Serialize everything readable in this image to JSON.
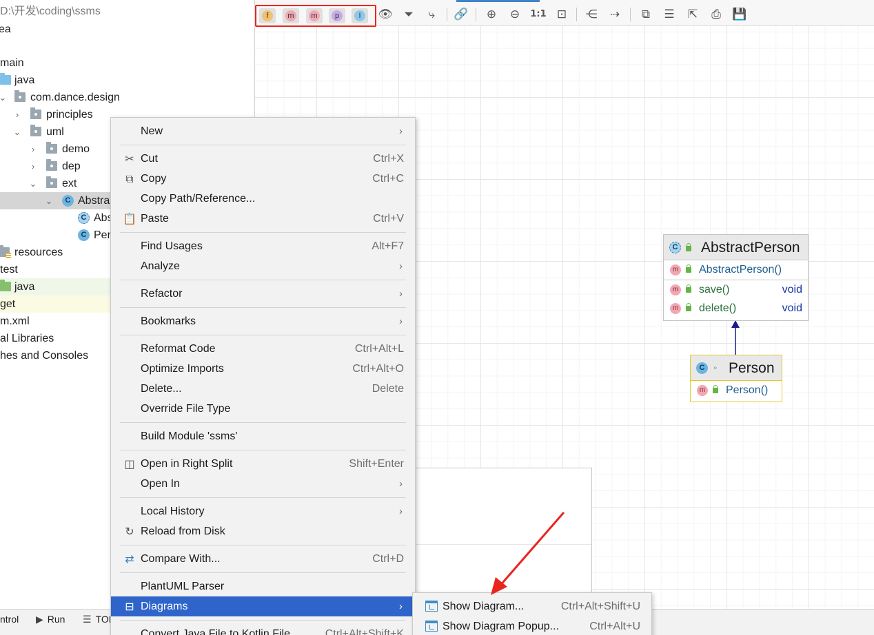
{
  "project": {
    "path_label": "D:\\开发\\coding\\ssms",
    "rows": [
      {
        "label": "ea"
      },
      {
        "label": ""
      },
      {
        "label": "main"
      },
      {
        "label": "java"
      },
      {
        "label": "com.dance.design"
      },
      {
        "label": "principles"
      },
      {
        "label": "uml"
      },
      {
        "label": "demo"
      },
      {
        "label": "dep"
      },
      {
        "label": "ext"
      },
      {
        "label": "AbstractPerson"
      },
      {
        "label": "AbstractPerson"
      },
      {
        "label": "Person"
      },
      {
        "label": "resources"
      },
      {
        "label": "test"
      },
      {
        "label": "java"
      },
      {
        "label": "get"
      },
      {
        "label": "m.xml"
      },
      {
        "label": "al Libraries"
      },
      {
        "label": "hes and Consoles"
      }
    ]
  },
  "bottom_bar": {
    "control_label": "ntrol",
    "run_label": "Run",
    "todo_label": "TODO"
  },
  "toolbar": {
    "filters": [
      {
        "letter": "f",
        "name": "fields",
        "color": "#f0c171"
      },
      {
        "letter": "m",
        "name": "constructors",
        "color": "#f2a7b3"
      },
      {
        "letter": "m",
        "name": "methods",
        "color": "#f2a7b3"
      },
      {
        "letter": "p",
        "name": "properties",
        "color": "#c7a8e8"
      },
      {
        "letter": "I",
        "name": "inner-classes",
        "color": "#8cc8e8"
      }
    ],
    "zoom_actual_label": "1:1"
  },
  "diagram": {
    "abstract_class": {
      "name": "AbstractPerson",
      "constructor": "AbstractPerson()",
      "methods": [
        {
          "name": "save()",
          "type": "void"
        },
        {
          "name": "delete()",
          "type": "void"
        }
      ]
    },
    "sub_class": {
      "name": "Person",
      "constructor": "Person()"
    }
  },
  "context_menu": {
    "new": "New",
    "cut": "Cut",
    "cut_sc": "Ctrl+X",
    "copy": "Copy",
    "copy_sc": "Ctrl+C",
    "copy_path": "Copy Path/Reference...",
    "paste": "Paste",
    "paste_sc": "Ctrl+V",
    "find_usages": "Find Usages",
    "find_usages_sc": "Alt+F7",
    "analyze": "Analyze",
    "refactor": "Refactor",
    "bookmarks": "Bookmarks",
    "reformat": "Reformat Code",
    "reformat_sc": "Ctrl+Alt+L",
    "optimize": "Optimize Imports",
    "optimize_sc": "Ctrl+Alt+O",
    "delete": "Delete...",
    "delete_sc": "Delete",
    "override": "Override File Type",
    "build_module": "Build Module 'ssms'",
    "open_right": "Open in Right Split",
    "open_right_sc": "Shift+Enter",
    "open_in": "Open In",
    "local_history": "Local History",
    "reload": "Reload from Disk",
    "compare": "Compare With...",
    "compare_sc": "Ctrl+D",
    "plantuml": "PlantUML Parser",
    "diagrams": "Diagrams",
    "convert": "Convert Java File to Kotlin File",
    "convert_sc": "Ctrl+Alt+Shift+K"
  },
  "submenu": {
    "show_diagram": "Show Diagram...",
    "show_diagram_sc": "Ctrl+Alt+Shift+U",
    "show_popup": "Show Diagram Popup...",
    "show_popup_sc": "Ctrl+Alt+U"
  },
  "colors": {
    "menu_highlight": "#2f65ca",
    "annotation_red": "#e8251f",
    "inheritance_arrow": "#1a1a8f"
  }
}
